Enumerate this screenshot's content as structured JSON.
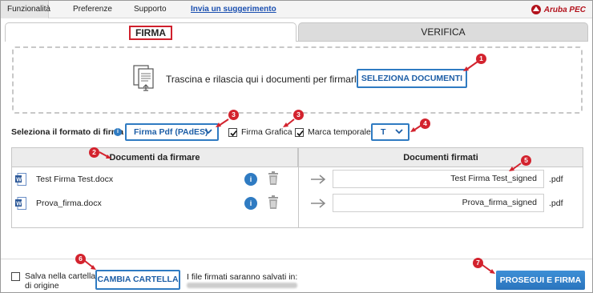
{
  "menu": {
    "items": [
      "Funzionalità",
      "Preferenze",
      "Supporto"
    ],
    "link": "Invia un suggerimento"
  },
  "brand": {
    "text": "Aruba PEC",
    "color": "#b3121c"
  },
  "tabs": {
    "firma": "FIRMA",
    "verifica": "VERIFICA"
  },
  "dropzone": {
    "text": "Trascina e rilascia qui i documenti per firmarli",
    "button": "SELEZIONA DOCUMENTI",
    "icon": "documents-upload-icon"
  },
  "format": {
    "label": "Seleziona il formato di firma",
    "info_icon": "i",
    "selected": "Firma Pdf (PAdES)",
    "firma_grafica": {
      "label": "Firma Grafica",
      "checked": true
    },
    "marca_temporale": {
      "label": "Marca temporale",
      "checked": true
    },
    "marca_selected": "T"
  },
  "table": {
    "header_left": "Documenti da firmare",
    "header_right": "Documenti firmati",
    "rows": [
      {
        "file": "Test Firma Test.docx",
        "output": "Test Firma Test_signed",
        "ext": ".pdf"
      },
      {
        "file": "Prova_firma.docx",
        "output": "Prova_firma_signed",
        "ext": ".pdf"
      }
    ]
  },
  "bottom": {
    "salva_label_1": "Salva nella cartella",
    "salva_label_2": "di origine",
    "salva_checked": false,
    "cambia_button": "CAMBIA CARTELLA",
    "saved_label": "I file firmati saranno salvati in:",
    "prosegui_button": "PROSEGUI E FIRMA"
  },
  "markers": [
    "1",
    "2",
    "3",
    "3",
    "4",
    "5",
    "6",
    "7"
  ],
  "colors": {
    "accent": "#2f7bc2",
    "marker": "#d3232e"
  }
}
